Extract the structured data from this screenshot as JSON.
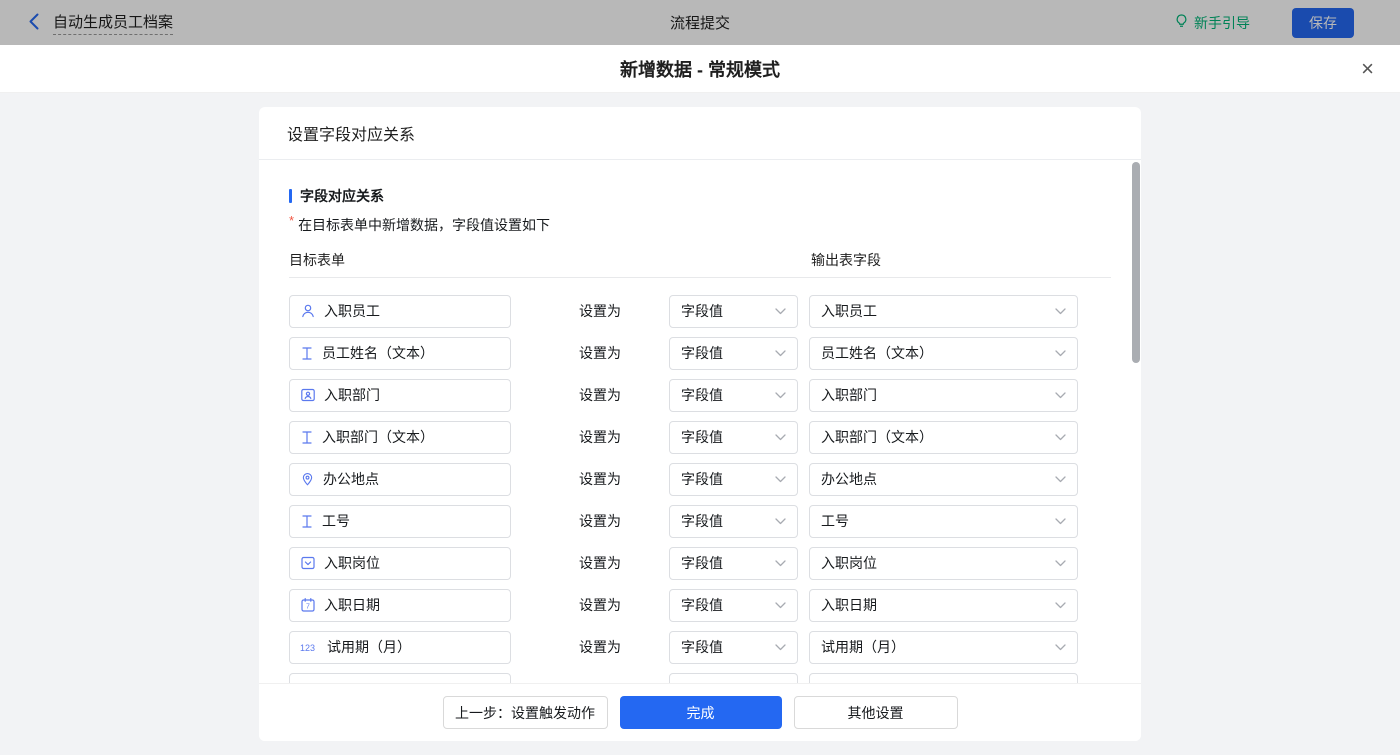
{
  "topbar": {
    "back_label": "自动生成员工档案",
    "center_title": "流程提交",
    "guide_label": "新手引导",
    "save_label": "保存"
  },
  "modal": {
    "title": "新增数据 - 常规模式",
    "close_glyph": "×"
  },
  "panel": {
    "header": "设置字段对应关系",
    "section_title": "字段对应关系",
    "required_mark": "*",
    "description": "在目标表单中新增数据，字段值设置如下",
    "columns": {
      "target": "目标表单",
      "output": "输出表字段"
    },
    "set_as_label": "设置为",
    "rows": [
      {
        "icon": "user-icon",
        "field": "入职员工",
        "operator": "字段值",
        "output": "入职员工"
      },
      {
        "icon": "text-icon",
        "field": "员工姓名（文本）",
        "operator": "字段值",
        "output": "员工姓名（文本）"
      },
      {
        "icon": "department-icon",
        "field": "入职部门",
        "operator": "字段值",
        "output": "入职部门"
      },
      {
        "icon": "text-icon",
        "field": "入职部门（文本）",
        "operator": "字段值",
        "output": "入职部门（文本）"
      },
      {
        "icon": "location-icon",
        "field": "办公地点",
        "operator": "字段值",
        "output": "办公地点"
      },
      {
        "icon": "text-icon",
        "field": "工号",
        "operator": "字段值",
        "output": "工号"
      },
      {
        "icon": "select-icon",
        "field": "入职岗位",
        "operator": "字段值",
        "output": "入职岗位"
      },
      {
        "icon": "calendar-icon",
        "field": "入职日期",
        "operator": "字段值",
        "output": "入职日期"
      },
      {
        "icon": "number-icon",
        "field": "试用期（月）",
        "operator": "字段值",
        "output": "试用期（月）"
      },
      {
        "icon": "",
        "field": "",
        "operator": "",
        "output": "",
        "partial": true
      }
    ],
    "footer": {
      "prev_label": "上一步：设置触发动作",
      "done_label": "完成",
      "other_label": "其他设置"
    }
  },
  "colors": {
    "accent_blue": "#2468f2",
    "guide_green": "#00b578",
    "required_red": "#f25643",
    "page_bg": "#f2f3f5",
    "field_icon_blue": "#5b79ee"
  }
}
